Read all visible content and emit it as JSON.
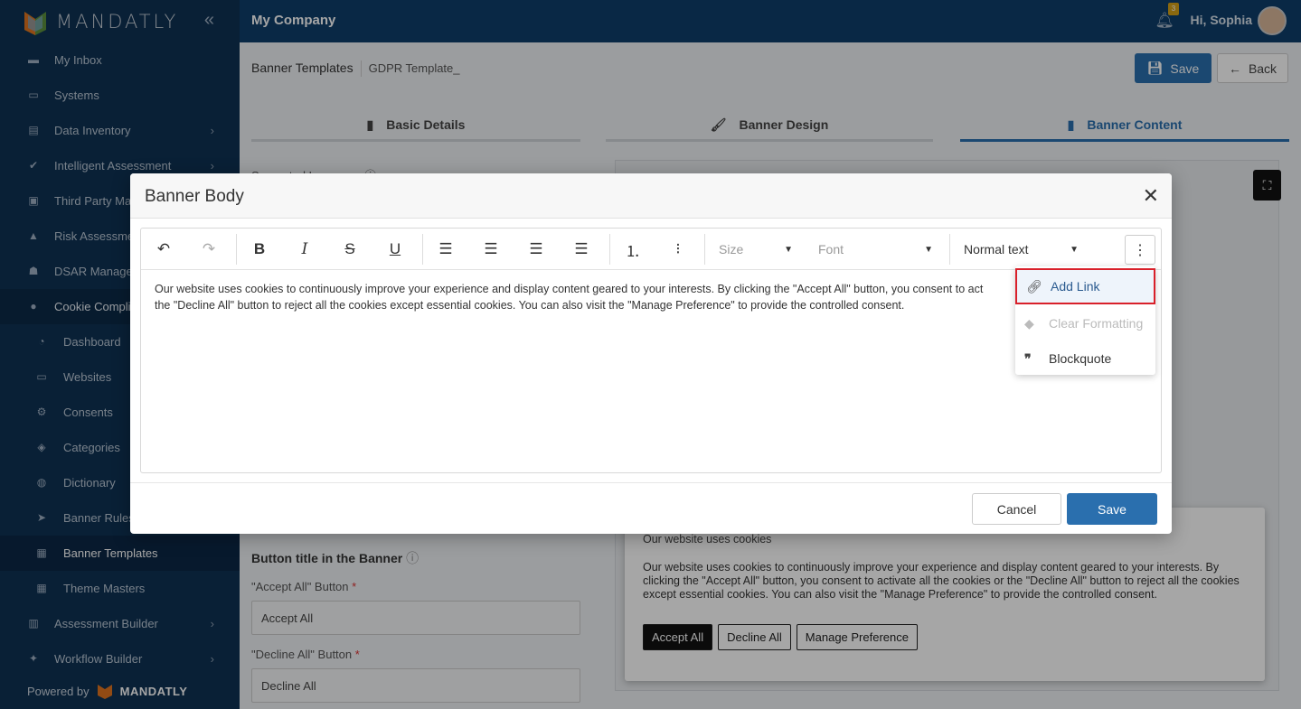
{
  "brand": {
    "name": "MANDATLY",
    "powered_by": "Powered by"
  },
  "topbar": {
    "company": "My Company",
    "greeting": "Hi, Sophia",
    "notification_count": "3"
  },
  "sidebar": {
    "items": [
      {
        "label": "My Inbox",
        "icon": "inbox-icon"
      },
      {
        "label": "Systems",
        "icon": "monitor-icon"
      },
      {
        "label": "Data Inventory",
        "icon": "database-icon"
      },
      {
        "label": "Intelligent Assessment",
        "icon": "check-icon"
      },
      {
        "label": "Third Party Ma",
        "icon": "contact-icon"
      },
      {
        "label": "Risk Assessme",
        "icon": "warning-icon"
      },
      {
        "label": "DSAR Manage",
        "icon": "user-shield-icon"
      },
      {
        "label": "Cookie Compli",
        "icon": "cookie-icon"
      },
      {
        "label": "Dashboard",
        "icon": "pie-icon"
      },
      {
        "label": "Websites",
        "icon": "window-icon"
      },
      {
        "label": "Consents",
        "icon": "gear-icon"
      },
      {
        "label": "Categories",
        "icon": "tag-icon"
      },
      {
        "label": "Dictionary",
        "icon": "globe-icon"
      },
      {
        "label": "Banner Rules",
        "icon": "send-icon"
      },
      {
        "label": "Banner Templates",
        "icon": "template-icon"
      },
      {
        "label": "Theme Masters",
        "icon": "grid-icon"
      },
      {
        "label": "Assessment Builder",
        "icon": "clipboard-icon"
      },
      {
        "label": "Workflow Builder",
        "icon": "pin-icon"
      }
    ]
  },
  "header": {
    "breadcrumb_main": "Banner Templates",
    "breadcrumb_sub": "GDPR Template_",
    "save_label": "Save",
    "back_label": "Back"
  },
  "tabs": [
    {
      "label": "Basic Details"
    },
    {
      "label": "Banner Design"
    },
    {
      "label": "Banner Content"
    }
  ],
  "form": {
    "supported_language": "Supported Language",
    "button_title": "Button title in the Banner",
    "accept_label": "\"Accept All\" Button",
    "accept_value": "Accept All",
    "decline_label": "\"Decline All\" Button",
    "decline_value": "Decline All"
  },
  "preview": {
    "title": "Our website uses cookies",
    "body": "Our website uses cookies to continuously improve your experience and display content geared to your interests. By clicking the \"Accept All\" button, you consent to activate all the cookies or the \"Decline All\" button to reject all the cookies except essential cookies. You can also visit the \"Manage Preference\" to provide the controlled consent.",
    "btn_accept": "Accept All",
    "btn_decline": "Decline All",
    "btn_manage": "Manage Preference"
  },
  "modal": {
    "title": "Banner Body",
    "size_placeholder": "Size",
    "font_placeholder": "Font",
    "text_style": "Normal text",
    "editor_text": "Our website uses cookies to continuously improve your experience and display content geared to your interests. By clicking the \"Accept All\" button, you consent to act",
    "editor_text2": "the \"Decline All\" button to reject all the cookies except essential cookies. You can also visit the \"Manage Preference\" to provide the controlled consent.",
    "menu": [
      {
        "label": "Add Link",
        "icon": "link-icon"
      },
      {
        "label": "Clear Formatting",
        "icon": "eraser-icon"
      },
      {
        "label": "Blockquote",
        "icon": "quote-icon"
      }
    ],
    "cancel_label": "Cancel",
    "save_label": "Save"
  }
}
